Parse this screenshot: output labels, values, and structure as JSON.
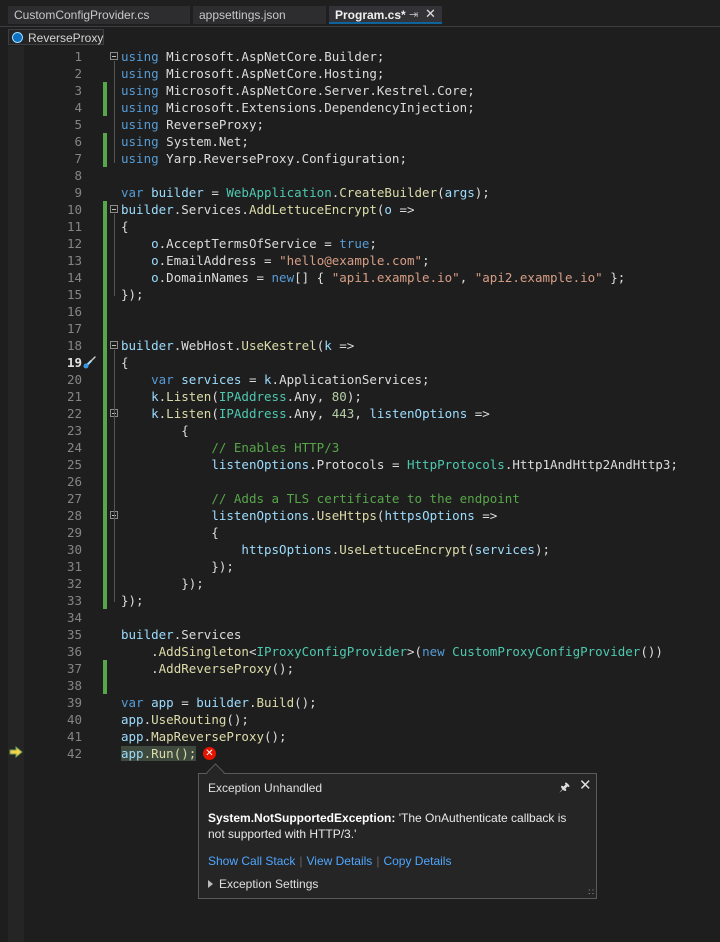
{
  "tabs": [
    {
      "label": "CustomConfigProvider.cs"
    },
    {
      "label": "appsettings.json"
    },
    {
      "label": "Program.cs*",
      "pin_icon": "pin-icon",
      "close_icon": "close-icon"
    }
  ],
  "navbar": {
    "project": "ReverseProxy",
    "icon": "csharp-project-icon"
  },
  "editor": {
    "line_numbers": [
      "1",
      "2",
      "3",
      "4",
      "5",
      "6",
      "7",
      "8",
      "9",
      "10",
      "11",
      "12",
      "13",
      "14",
      "15",
      "16",
      "17",
      "18",
      "19",
      "20",
      "21",
      "22",
      "23",
      "24",
      "25",
      "26",
      "27",
      "28",
      "29",
      "30",
      "31",
      "32",
      "33",
      "34",
      "35",
      "36",
      "37",
      "38",
      "39",
      "40",
      "41",
      "42"
    ],
    "current_line": "19",
    "execution_line": "42",
    "lines": [
      "using Microsoft.AspNetCore.Builder;",
      "using Microsoft.AspNetCore.Hosting;",
      "using Microsoft.AspNetCore.Server.Kestrel.Core;",
      "using Microsoft.Extensions.DependencyInjection;",
      "using ReverseProxy;",
      "using System.Net;",
      "using Yarp.ReverseProxy.Configuration;",
      "",
      "var builder = WebApplication.CreateBuilder(args);",
      "builder.Services.AddLettuceEncrypt(o =>",
      "{",
      "    o.AcceptTermsOfService = true;",
      "    o.EmailAddress = \"hello@example.com\";",
      "    o.DomainNames = new[] { \"api1.example.io\", \"api2.example.io\" };",
      "});",
      "",
      "",
      "builder.WebHost.UseKestrel(k =>",
      "{",
      "    var services = k.ApplicationServices;",
      "    k.Listen(IPAddress.Any, 80);",
      "    k.Listen(IPAddress.Any, 443, listenOptions =>",
      "        {",
      "            // Enables HTTP/3",
      "            listenOptions.Protocols = HttpProtocols.Http1AndHttp2AndHttp3;",
      "",
      "            // Adds a TLS certificate to the endpoint",
      "            listenOptions.UseHttps(httpsOptions =>",
      "            {",
      "                httpsOptions.UseLettuceEncrypt(services);",
      "            });",
      "        });",
      "});",
      "",
      "builder.Services",
      "    .AddSingleton<IProxyConfigProvider>(new CustomProxyConfigProvider())",
      "    .AddReverseProxy();",
      "",
      "var app = builder.Build();",
      "app.UseRouting();",
      "app.MapReverseProxy();",
      "app.Run();"
    ]
  },
  "exception_popup": {
    "title": "Exception Unhandled",
    "exception_type": "System.NotSupportedException:",
    "message": " 'The OnAuthenticate callback is not supported with HTTP/3.'",
    "links": [
      "Show Call Stack",
      "View Details",
      "Copy Details"
    ],
    "settings_label": "Exception Settings"
  },
  "colors": {
    "keyword": "#569cd6",
    "type": "#4ec9b0",
    "method": "#dcdcaa",
    "string": "#d69d85",
    "comment": "#57a64a",
    "change_bar": "#57a64a",
    "error": "#e51400",
    "link": "#4fa6ff"
  }
}
